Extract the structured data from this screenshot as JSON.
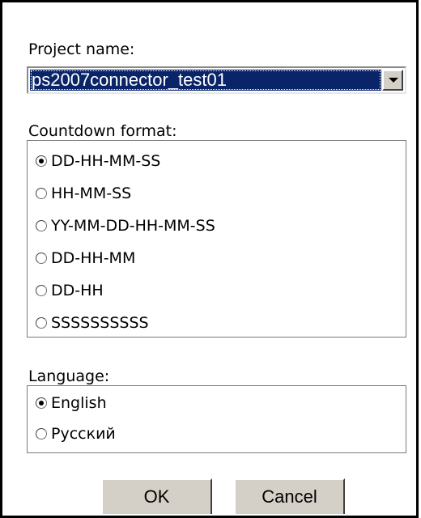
{
  "project": {
    "label": "Project name:",
    "selected": "ps2007connector_test01"
  },
  "countdown": {
    "label": "Countdown format:",
    "options": [
      {
        "label": "DD-HH-MM-SS",
        "checked": true
      },
      {
        "label": "HH-MM-SS",
        "checked": false
      },
      {
        "label": "YY-MM-DD-HH-MM-SS",
        "checked": false
      },
      {
        "label": "DD-HH-MM",
        "checked": false
      },
      {
        "label": "DD-HH",
        "checked": false
      },
      {
        "label": "SSSSSSSSSS",
        "checked": false
      }
    ]
  },
  "language": {
    "label": "Language:",
    "options": [
      {
        "label": "English",
        "checked": true
      },
      {
        "label": "Русский",
        "checked": false
      }
    ]
  },
  "buttons": {
    "ok": "OK",
    "cancel": "Cancel"
  },
  "colors": {
    "selection": "#0a246a",
    "button_face": "#d4d0c8"
  }
}
